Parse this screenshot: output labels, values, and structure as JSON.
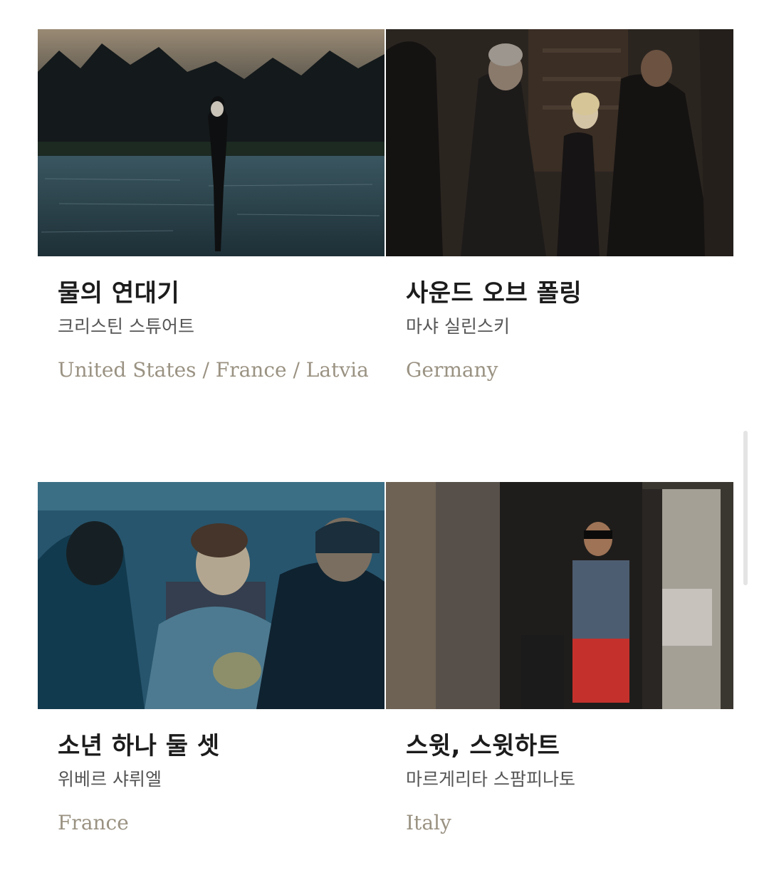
{
  "films": [
    {
      "title": "물의 연대기",
      "director": "크리스틴 스튜어트",
      "country": "United States / France / Latvia"
    },
    {
      "title": "사운드 오브 폴링",
      "director": "마샤 실린스키",
      "country": "Germany"
    },
    {
      "title": "소년 하나 둘 셋",
      "director": "위베르 샤뤼엘",
      "country": "France"
    },
    {
      "title": "스윗, 스윗하트",
      "director": "마르게리타 스팜피나토",
      "country": "Italy"
    }
  ],
  "colors": {
    "title": "#1c1c1c",
    "director": "#555555",
    "country": "#9a9282"
  }
}
